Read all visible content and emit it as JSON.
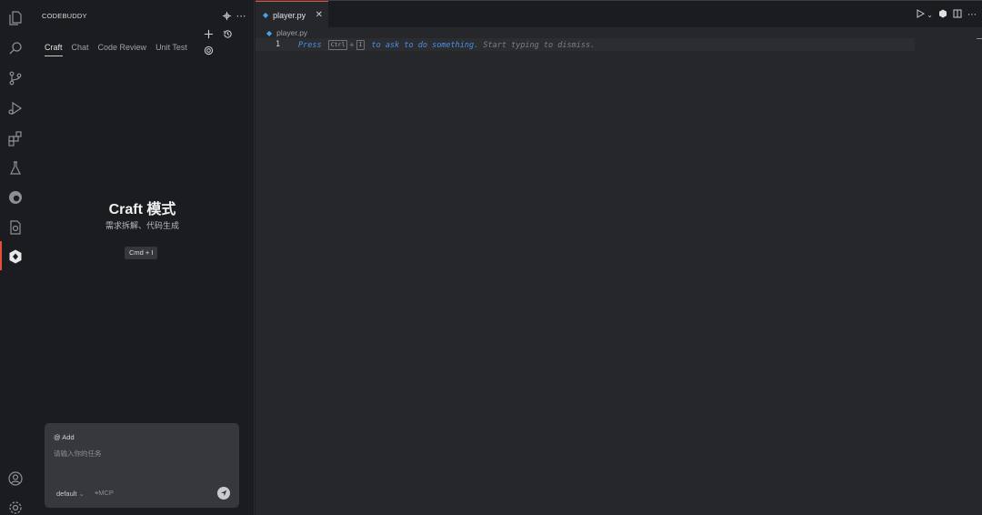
{
  "sidebar": {
    "title": "CODEBUDDY",
    "tabs": [
      {
        "label": "Craft",
        "active": true
      },
      {
        "label": "Chat",
        "active": false
      },
      {
        "label": "Code Review",
        "active": false
      },
      {
        "label": "Unit Test",
        "active": false
      }
    ],
    "hero": {
      "title": "Craft 模式",
      "subtitle": "需求拆解、代码生成",
      "shortcut": "Cmd + I"
    },
    "composer": {
      "add_label": "@ Add",
      "placeholder": "请输入你的任务",
      "model": "default",
      "mcp_label": "MCP"
    }
  },
  "editor": {
    "tab": {
      "filename": "player.py",
      "close": "✕"
    },
    "breadcrumb": "player.py",
    "line_number": "1",
    "hint": {
      "press": "Press",
      "key1": "Ctrl",
      "plus": "+",
      "key2": "I",
      "action": "to ask to do something.",
      "rest": "Start typing to dismiss."
    }
  },
  "colors": {
    "accent": "#e54d3c",
    "file_icon": "#4aa3e6",
    "hint_link": "#4c8fe3"
  }
}
